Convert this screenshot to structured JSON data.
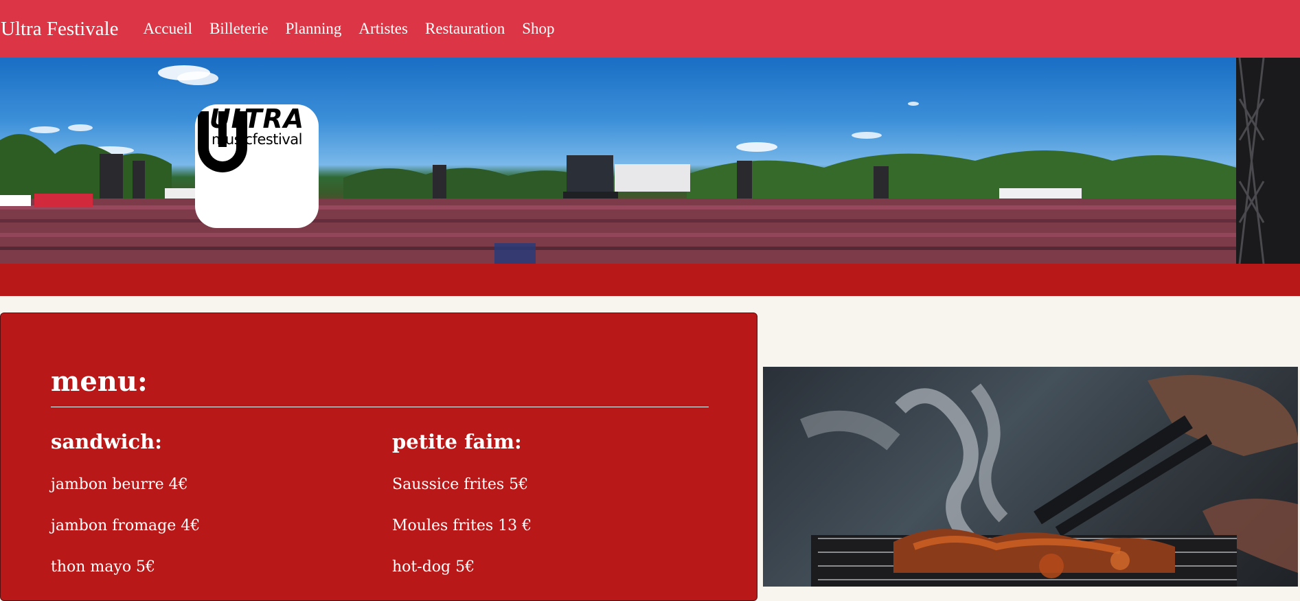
{
  "nav": {
    "brand": "Ultra Festivale",
    "links": [
      "Accueil",
      "Billeterie",
      "Planning",
      "Artistes",
      "Restauration",
      "Shop"
    ]
  },
  "hero": {
    "logo": {
      "line1": "ULTRA",
      "line2": "musicfestival"
    }
  },
  "menu": {
    "title": "menu:",
    "columns": [
      {
        "heading": "sandwich:",
        "items": [
          "jambon beurre 4€",
          "jambon fromage 4€",
          "thon mayo 5€"
        ]
      },
      {
        "heading": "petite faim:",
        "items": [
          "Saussice frites 5€",
          "Moules frites 13 €",
          "hot-dog 5€"
        ]
      }
    ]
  },
  "colors": {
    "nav_bg": "#dc3545",
    "band_red": "#b91818",
    "page_bg": "#f8f5ef"
  }
}
